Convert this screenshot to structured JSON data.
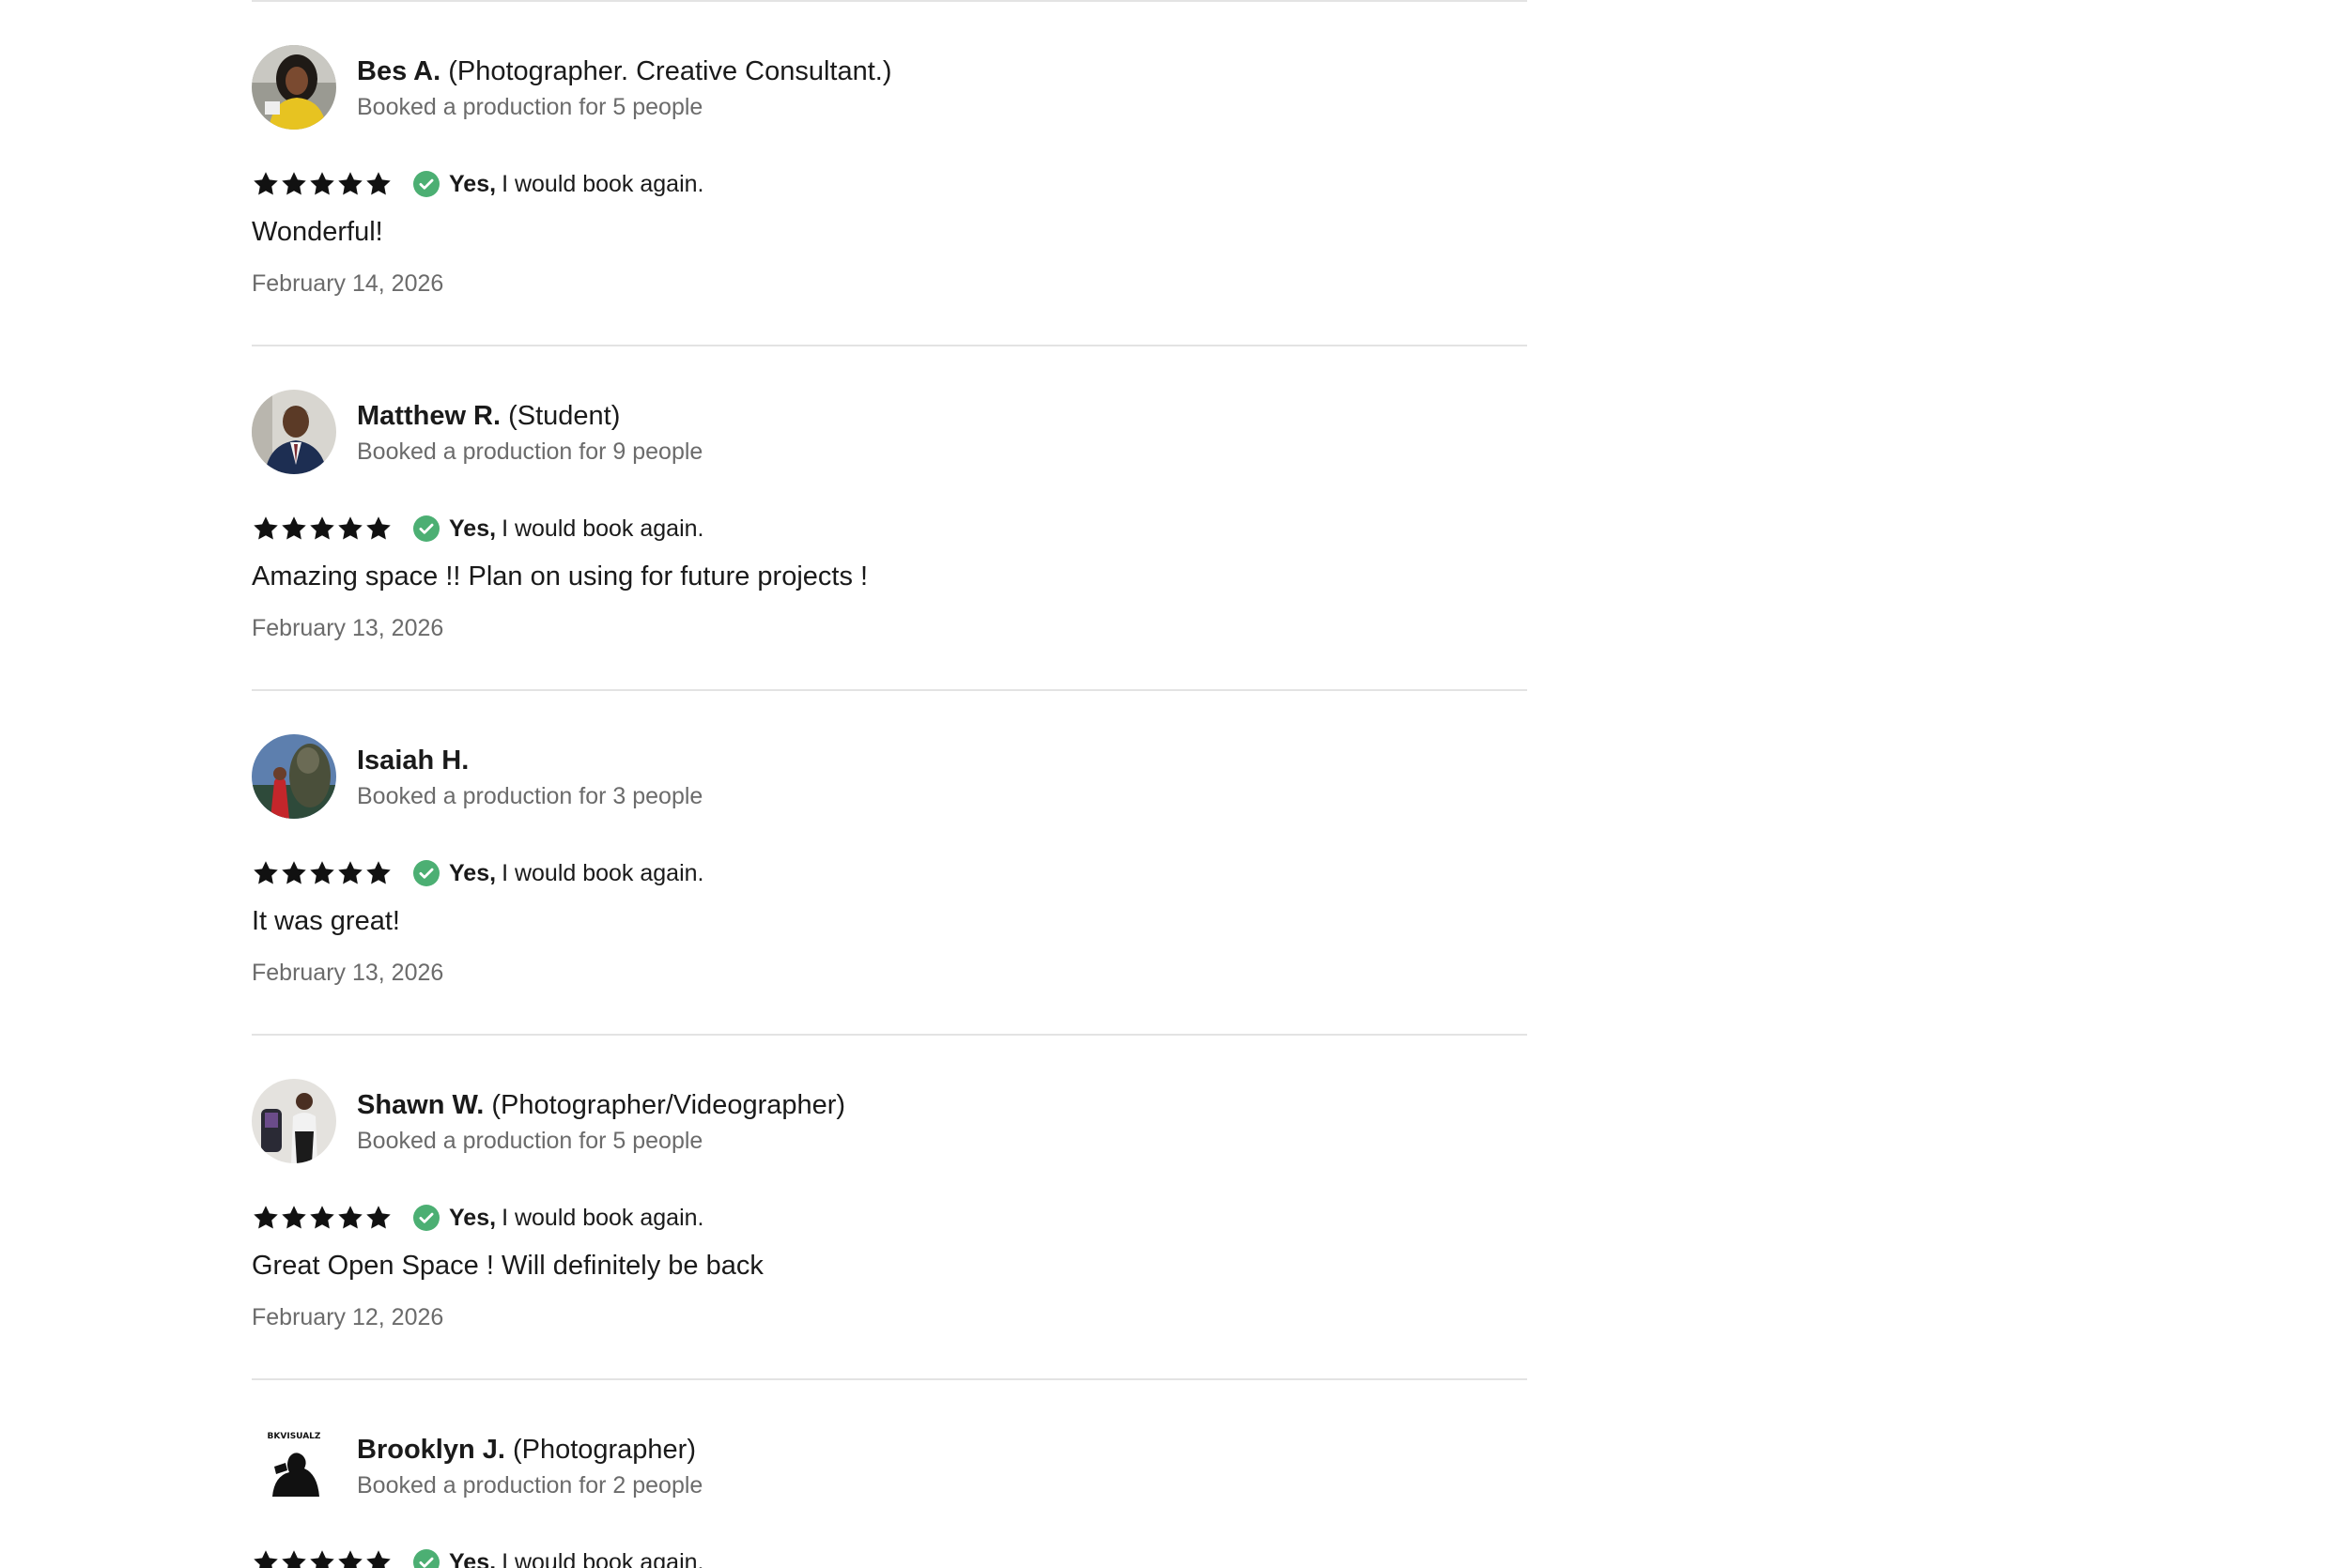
{
  "reviews": [
    {
      "name": "Bes A.",
      "role": "(Photographer. Creative Consultant.)",
      "booking": "Booked a production for 5 people",
      "rating": 5,
      "rebook_yes": "Yes,",
      "rebook_text": "I would book again.",
      "comment": "Wonderful!",
      "date": "February 14, 2026"
    },
    {
      "name": "Matthew R.",
      "role": "(Student)",
      "booking": "Booked a production for 9 people",
      "rating": 5,
      "rebook_yes": "Yes,",
      "rebook_text": "I would book again.",
      "comment": "Amazing space !! Plan on using for future projects !",
      "date": "February 13, 2026"
    },
    {
      "name": "Isaiah H.",
      "role": "",
      "booking": "Booked a production for 3 people",
      "rating": 5,
      "rebook_yes": "Yes,",
      "rebook_text": "I would book again.",
      "comment": "It was great!",
      "date": "February 13, 2026"
    },
    {
      "name": "Shawn W.",
      "role": "(Photographer/Videographer)",
      "booking": "Booked a production for 5 people",
      "rating": 5,
      "rebook_yes": "Yes,",
      "rebook_text": "I would book again.",
      "comment": "Great Open Space ! Will definitely be back",
      "date": "February 12, 2026"
    },
    {
      "name": "Brooklyn J.",
      "role": "(Photographer)",
      "booking": "Booked a production for 2 people",
      "rating": 5,
      "rebook_yes": "Yes,",
      "rebook_text": "I would book again.",
      "comment": "",
      "date": ""
    }
  ],
  "avatar_logo_text": "BKVISUALZ",
  "colors": {
    "check": "#4caf73",
    "star": "#111111",
    "divider": "#e3e3e3",
    "muted_text": "#6b6b6b"
  },
  "icons": {
    "star": "star-icon",
    "check": "check-circle-icon",
    "avatar": "avatar"
  }
}
